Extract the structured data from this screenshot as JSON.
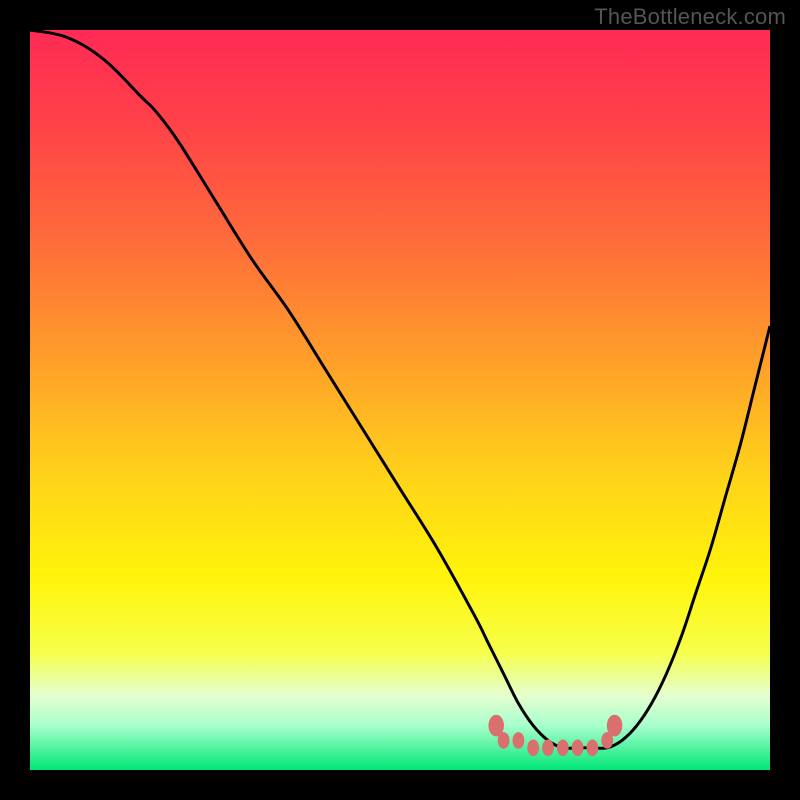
{
  "watermark": "TheBottleneck.com",
  "colors": {
    "curve": "#000000",
    "dot_fill": "#d9706d",
    "dot_stroke": "#d9706d",
    "gradient_stops": [
      {
        "offset": 0.0,
        "hex": "#ff2a55"
      },
      {
        "offset": 0.12,
        "hex": "#ff4049"
      },
      {
        "offset": 0.28,
        "hex": "#ff6a3b"
      },
      {
        "offset": 0.45,
        "hex": "#ffa029"
      },
      {
        "offset": 0.6,
        "hex": "#ffd21a"
      },
      {
        "offset": 0.74,
        "hex": "#fff40a"
      },
      {
        "offset": 0.84,
        "hex": "#f6ff4a"
      },
      {
        "offset": 0.9,
        "hex": "#e4ffd0"
      },
      {
        "offset": 0.94,
        "hex": "#a8ffcc"
      },
      {
        "offset": 1.0,
        "hex": "#00e676"
      }
    ]
  },
  "chart_data": {
    "type": "line",
    "title": "",
    "xlabel": "",
    "ylabel": "",
    "xlim": [
      0,
      100
    ],
    "ylim": [
      0,
      100
    ],
    "series": [
      {
        "name": "bottleneck-curve",
        "x": [
          0,
          5,
          10,
          15,
          17,
          20,
          25,
          30,
          35,
          40,
          45,
          50,
          55,
          60,
          62,
          64,
          66,
          68,
          70,
          72,
          74,
          76,
          78,
          80,
          82,
          84,
          86,
          88,
          90,
          92,
          94,
          96,
          98,
          100
        ],
        "values": [
          100,
          99,
          96,
          91,
          89,
          85,
          77,
          69,
          62,
          54,
          46,
          38,
          30,
          21,
          17,
          13,
          9,
          6,
          4,
          3,
          3,
          3,
          3,
          4,
          6,
          9,
          13,
          18,
          24,
          30,
          37,
          44,
          52,
          60
        ]
      }
    ],
    "highlight_dots": {
      "name": "flat-region",
      "x": [
        64,
        66,
        68,
        70,
        72,
        74,
        76,
        78
      ],
      "values": [
        4,
        4,
        3,
        3,
        3,
        3,
        3,
        4
      ]
    },
    "highlight_end_dots": {
      "name": "flat-region-ends",
      "x": [
        63,
        79
      ],
      "values": [
        6,
        6
      ]
    }
  }
}
